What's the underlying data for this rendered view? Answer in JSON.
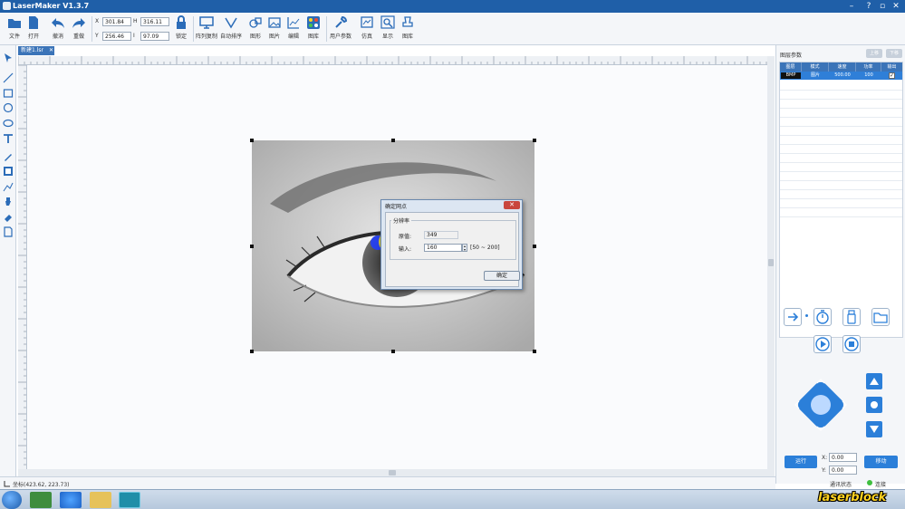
{
  "window": {
    "title": "LaserMaker V1.3.7"
  },
  "toolbar": {
    "file": "文件",
    "open": "打开",
    "undo": "撤消",
    "redo": "重做",
    "x_value": "301.84",
    "y_value": "256.46",
    "w_value": "316.11",
    "h_value": "97.09",
    "lock": "锁定",
    "array_copy": "阵列复制",
    "auto_layout": "自动排序",
    "shape": "图形",
    "image": "图片",
    "edit": "编辑",
    "library": "图库",
    "user_params": "用户参数",
    "simulate": "仿真",
    "preview": "显示",
    "gallery": "图库"
  },
  "document_tab": {
    "name": "新建1.lsr"
  },
  "dialog": {
    "title": "确定网点",
    "group_label": "分辨率",
    "source_label": "原值:",
    "source_value": "349",
    "input_label": "输入:",
    "input_value": "160",
    "range_text": "[50  ~  200]",
    "ok_label": "确定"
  },
  "right_panel": {
    "title": "图层参数",
    "btn_up": "上移",
    "btn_down": "下移",
    "table_headers": [
      "图层",
      "模式",
      "速度",
      "功率",
      "输出"
    ],
    "layer_row": {
      "mode": "BMP",
      "type": "图片",
      "speed": "500.00",
      "power": "100",
      "output_checked": true
    },
    "connection_status": "连接",
    "machine_status": "通讯状态",
    "x_label": "X:",
    "x_value": "0.00",
    "y_label": "Y:",
    "y_value": "0.00",
    "btn_run": "运行",
    "btn_move": "移动"
  },
  "status": {
    "position_text": "坐标(423.62, 223.73)"
  },
  "watermark": "laserblock",
  "colors": {
    "accent": "#2b7fd9",
    "titlebar": "#1f5fa8",
    "highlight": "#ffe000"
  }
}
